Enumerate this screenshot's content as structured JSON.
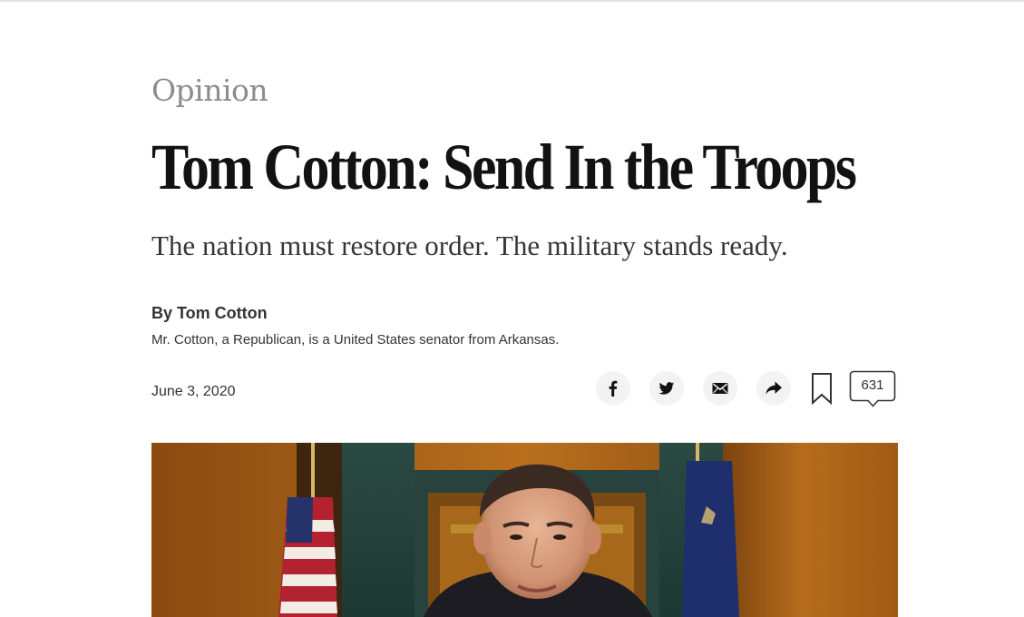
{
  "article": {
    "section": "Opinion",
    "headline": "Tom Cotton: Send In the Troops",
    "summary": "The nation must restore order. The military stands ready.",
    "byline": {
      "prefix": "By",
      "author": "Tom Cotton"
    },
    "author_bio": "Mr. Cotton, a Republican, is a United States senator from Arkansas.",
    "date": "June 3, 2020"
  },
  "share_tools": {
    "buttons": [
      {
        "name": "facebook",
        "icon": "facebook-icon"
      },
      {
        "name": "twitter",
        "icon": "twitter-icon"
      },
      {
        "name": "email",
        "icon": "email-icon"
      },
      {
        "name": "more",
        "icon": "share-arrow-icon"
      }
    ],
    "save_icon": "bookmark-icon",
    "comments_count": "631"
  },
  "colors": {
    "section_gray": "#8c8c8c",
    "headline": "#121212",
    "body_text": "#333333",
    "share_button_bg": "#f3f3f3"
  }
}
